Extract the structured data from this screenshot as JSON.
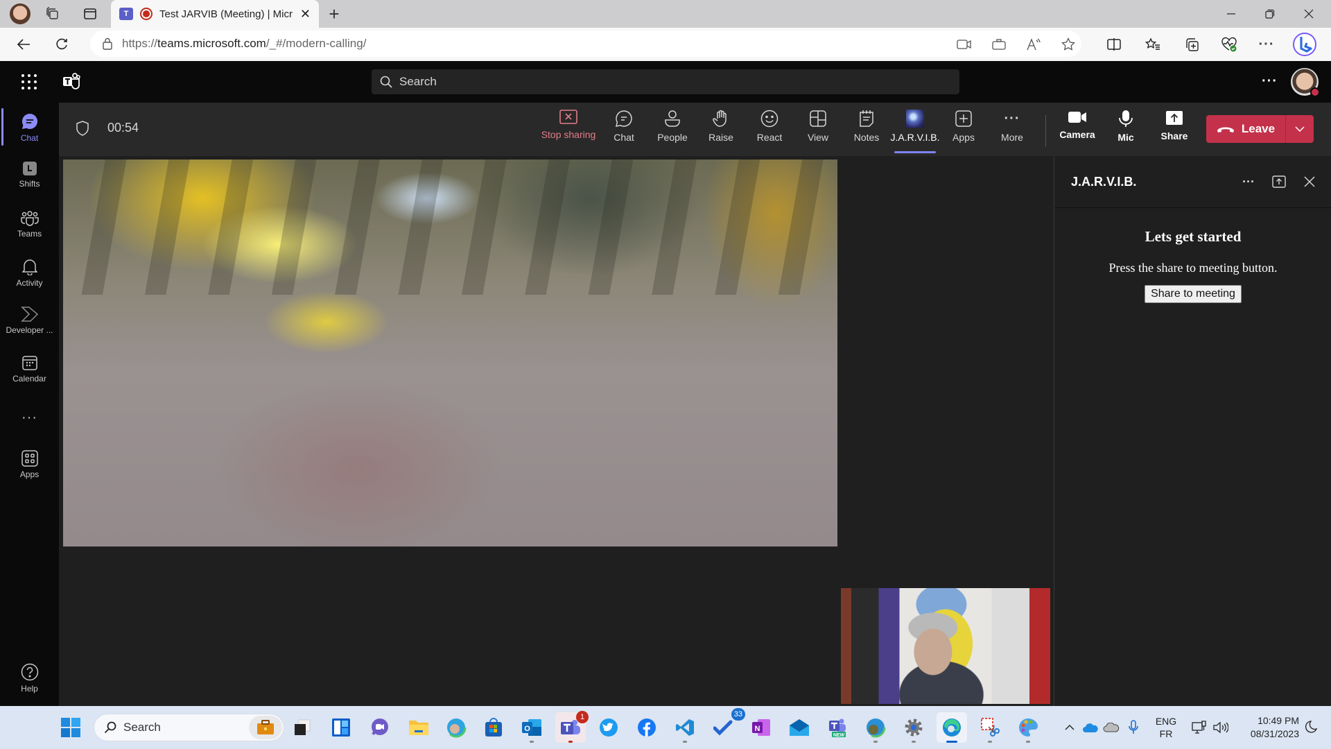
{
  "browser": {
    "tab_title": "Test JARVIB (Meeting) | Micr",
    "url_prefix": "https://",
    "url_host": "teams.microsoft.com",
    "url_path": "/_#/modern-calling/",
    "window_controls": [
      "minimize",
      "restore",
      "close"
    ]
  },
  "teams_header": {
    "search_placeholder": "Search"
  },
  "rail": {
    "items": [
      {
        "label": "Chat",
        "icon": "chat-icon",
        "active": true
      },
      {
        "label": "Shifts",
        "icon": "shifts-icon"
      },
      {
        "label": "Teams",
        "icon": "teams-icon"
      },
      {
        "label": "Activity",
        "icon": "bell-icon"
      },
      {
        "label": "Developer ...",
        "icon": "developer-portal-icon"
      },
      {
        "label": "Calendar",
        "icon": "calendar-icon"
      },
      {
        "label": "...",
        "icon": "more-icon"
      },
      {
        "label": "Apps",
        "icon": "apps-icon"
      }
    ],
    "help_label": "Help"
  },
  "meeting": {
    "timer": "00:54",
    "toolbar": [
      {
        "id": "stop-sharing",
        "label": "Stop sharing"
      },
      {
        "id": "chat",
        "label": "Chat"
      },
      {
        "id": "people",
        "label": "People"
      },
      {
        "id": "raise",
        "label": "Raise"
      },
      {
        "id": "react",
        "label": "React"
      },
      {
        "id": "view",
        "label": "View"
      },
      {
        "id": "notes",
        "label": "Notes"
      },
      {
        "id": "jarvib",
        "label": "J.A.R.V.I.B.",
        "selected": true
      },
      {
        "id": "apps",
        "label": "Apps"
      },
      {
        "id": "more",
        "label": "More"
      },
      {
        "id": "camera",
        "label": "Camera"
      },
      {
        "id": "mic",
        "label": "Mic"
      },
      {
        "id": "share",
        "label": "Share"
      }
    ],
    "leave_label": "Leave",
    "leave_color": "#c4314b",
    "accent_color": "#7f85f5"
  },
  "side_panel": {
    "title": "J.A.R.V.I.B.",
    "heading": "Lets get started",
    "text": "Press the share to meeting button.",
    "button_label": "Share to meeting"
  },
  "taskbar": {
    "search_placeholder": "Search",
    "apps": [
      {
        "name": "task-view"
      },
      {
        "name": "widgets"
      },
      {
        "name": "teams-chat"
      },
      {
        "name": "file-explorer"
      },
      {
        "name": "edge-profile"
      },
      {
        "name": "microsoft-store"
      },
      {
        "name": "outlook"
      },
      {
        "name": "teams",
        "badge": "1"
      },
      {
        "name": "twitter"
      },
      {
        "name": "facebook"
      },
      {
        "name": "vscode"
      },
      {
        "name": "todo",
        "badge": "33"
      },
      {
        "name": "onenote"
      },
      {
        "name": "mail"
      },
      {
        "name": "teams-new",
        "sublabel": "NEW"
      },
      {
        "name": "edge-dev"
      },
      {
        "name": "settings"
      },
      {
        "name": "edge"
      },
      {
        "name": "snipping-tool"
      },
      {
        "name": "paint"
      }
    ],
    "tray": {
      "lang_top": "ENG",
      "lang_bottom": "FR",
      "time": "10:49 PM",
      "date": "08/31/2023"
    }
  }
}
